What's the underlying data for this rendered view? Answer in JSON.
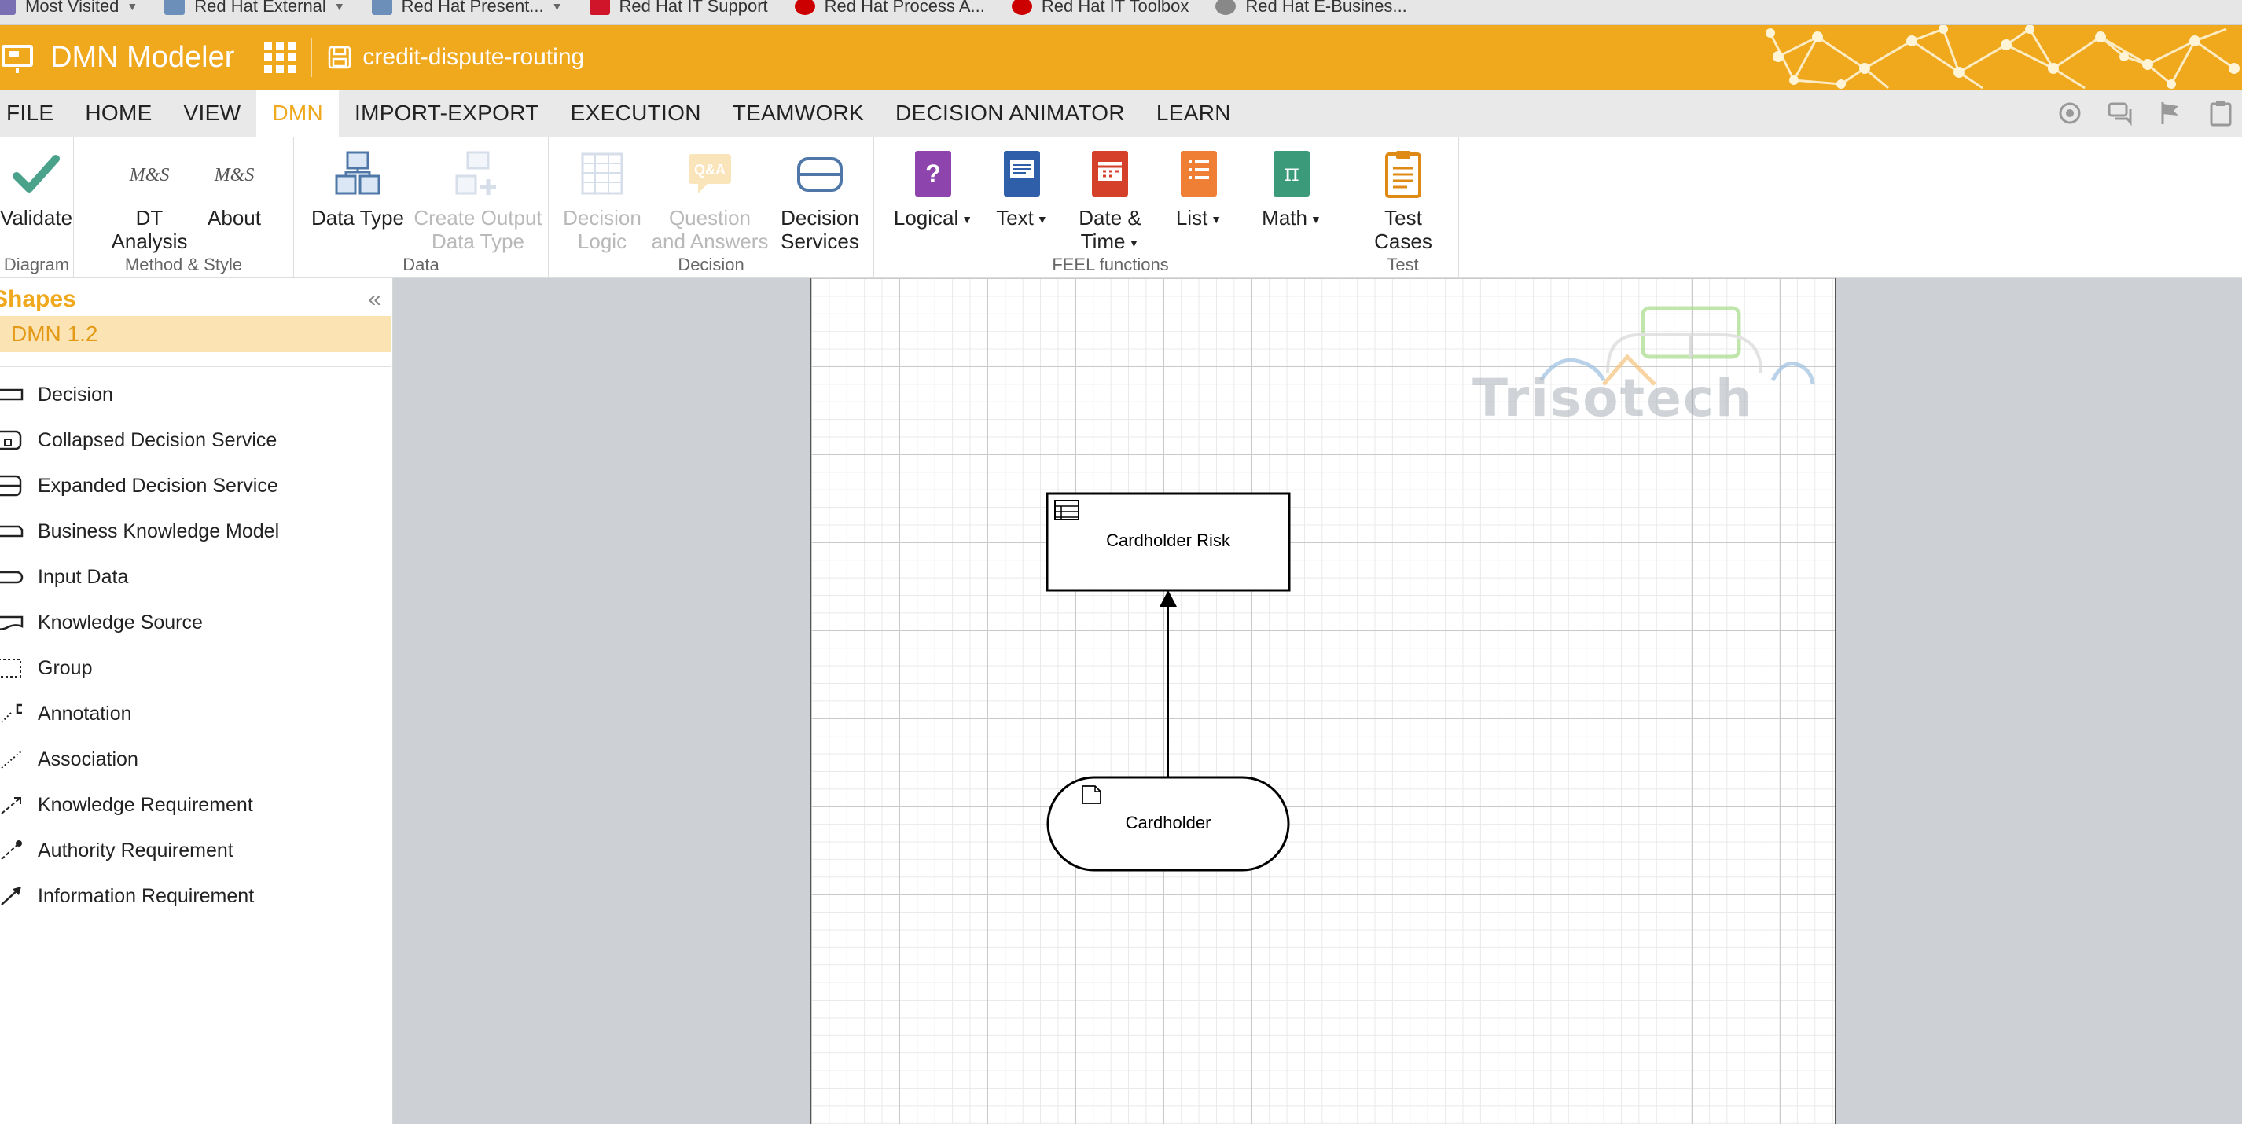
{
  "bookmarks": [
    {
      "label": "Most Visited",
      "icon": "gear-icon",
      "has_dropdown": true
    },
    {
      "label": "Red Hat External",
      "icon": "folder-icon",
      "has_dropdown": true
    },
    {
      "label": "Red Hat Present...",
      "icon": "folder-icon",
      "has_dropdown": true
    },
    {
      "label": "Red Hat IT Support",
      "icon": "servicenow-icon",
      "has_dropdown": false
    },
    {
      "label": "Red Hat Process A...",
      "icon": "redhat-icon",
      "has_dropdown": false
    },
    {
      "label": "Red Hat IT Toolbox",
      "icon": "redhat-icon",
      "has_dropdown": false
    },
    {
      "label": "Red Hat E-Busines...",
      "icon": "globe-icon",
      "has_dropdown": false
    }
  ],
  "header": {
    "app_title": "DMN Modeler",
    "document_name": "credit-dispute-routing",
    "accent_color": "#f0a81d"
  },
  "menu": {
    "items": [
      "FILE",
      "HOME",
      "VIEW",
      "DMN",
      "IMPORT-EXPORT",
      "EXECUTION",
      "TEAMWORK",
      "DECISION ANIMATOR",
      "LEARN"
    ],
    "active": "DMN",
    "right_icons": [
      "target-icon",
      "comments-icon",
      "flag-icon",
      "clipboard-icon"
    ]
  },
  "ribbon": {
    "groups": {
      "diagram": "Diagram",
      "method_style": "Method & Style",
      "data": "Data",
      "decision": "Decision",
      "feel": "FEEL functions",
      "test": "Test"
    },
    "buttons": {
      "validate": "Validate",
      "dt_analysis_1": "DT",
      "dt_analysis_2": "Analysis",
      "about": "About",
      "ms_logo": "M&S",
      "data_type": "Data Type",
      "create_output_1": "Create Output",
      "create_output_2": "Data Type",
      "decision_logic_1": "Decision",
      "decision_logic_2": "Logic",
      "qa_1": "Question",
      "qa_2": "and Answers",
      "qa_icon": "Q&A",
      "decision_services_1": "Decision",
      "decision_services_2": "Services",
      "logical": "Logical",
      "text": "Text",
      "date_time_1": "Date &",
      "date_time_2": "Time",
      "list": "List",
      "math": "Math",
      "math_symbol": "π",
      "test_cases_1": "Test",
      "test_cases_2": "Cases"
    }
  },
  "shapes_panel": {
    "title": "Shapes",
    "collapse_glyph": "«",
    "version": "DMN 1.2",
    "items": [
      "Decision",
      "Collapsed Decision Service",
      "Expanded Decision Service",
      "Business Knowledge Model",
      "Input Data",
      "Knowledge Source",
      "Group",
      "Annotation",
      "Association",
      "Knowledge Requirement",
      "Authority Requirement",
      "Information Requirement"
    ]
  },
  "diagram": {
    "watermark": "Trisotech",
    "nodes": {
      "decision": "Cardholder Risk",
      "input": "Cardholder"
    }
  }
}
